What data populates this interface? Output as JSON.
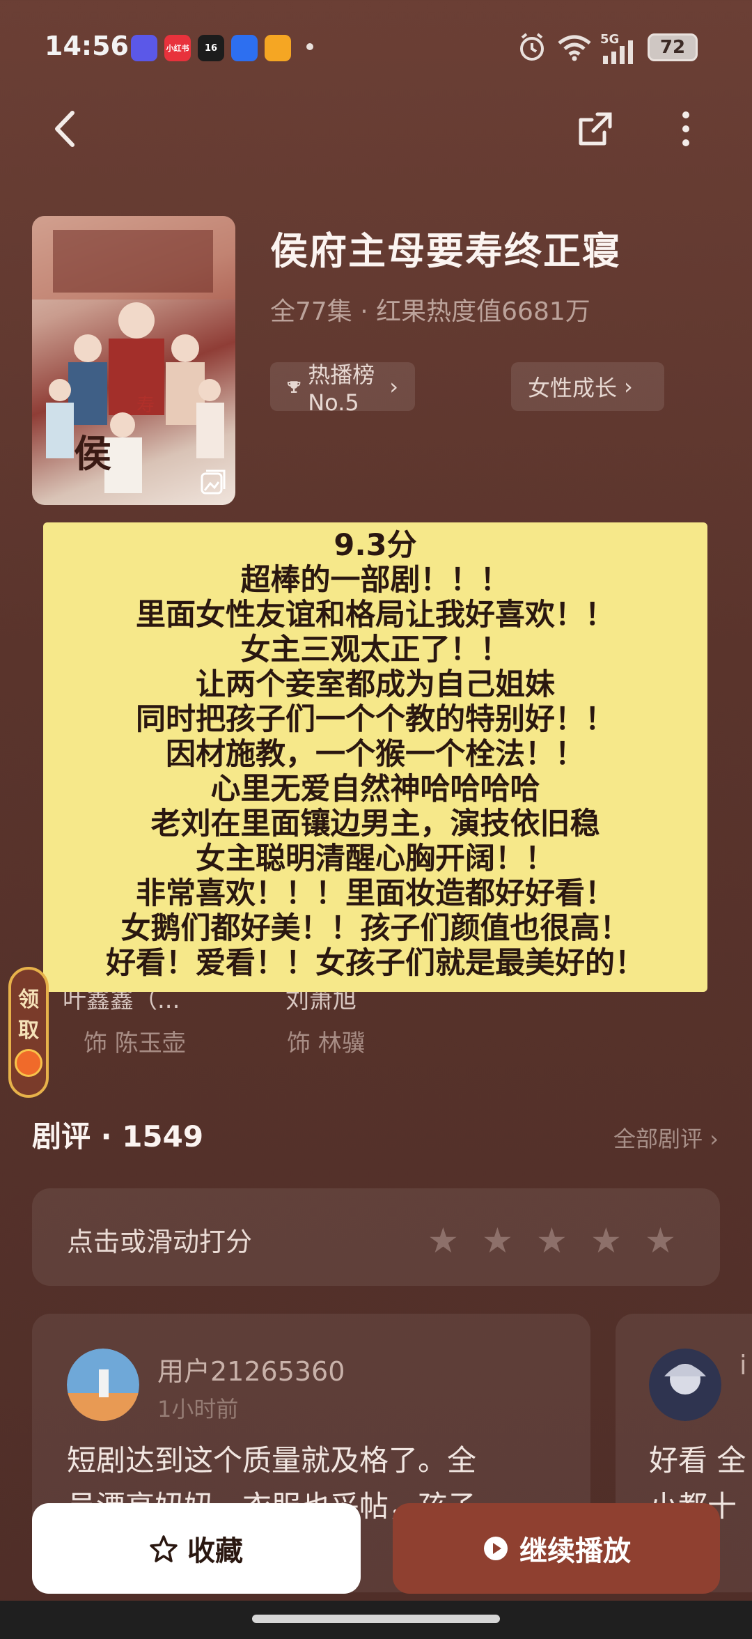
{
  "status_bar": {
    "time": "14:56",
    "apps": [
      {
        "label": "",
        "color": "#5b58e8"
      },
      {
        "label": "小红书",
        "color": "#e8323c"
      },
      {
        "label": "16",
        "color": "#1c1c1c"
      },
      {
        "label": "",
        "color": "#2d6ff0"
      },
      {
        "label": "",
        "color": "#f5a623"
      }
    ],
    "network": "5G",
    "battery": "72"
  },
  "show": {
    "title": "侯府主母要寿终正寝",
    "meta": "全77集 · 红果热度值6681万",
    "tags": [
      "热播榜 No.5",
      "女性成长"
    ]
  },
  "note_lines": [
    "9.3分",
    "超棒的一部剧！！！",
    "里面女性友谊和格局让我好喜欢！！",
    "女主三观太正了！！",
    "让两个妾室都成为自己姐妹",
    "同时把孩子们一个个教的特别好！！",
    "因材施教，一个猴一个栓法！！",
    "心里无爱自然神哈哈哈哈",
    "老刘在里面镶边男主，演技依旧稳",
    "女主聪明清醒心胸开阔！！",
    "非常喜欢！！！里面妆造都好好看！",
    "女鹅们都好美！！孩子们颜值也很高！",
    "好看！爱看！！女孩子们就是最美好的！"
  ],
  "cast": [
    {
      "name": "叶鑫鑫（...",
      "role": "饰 陈玉壶"
    },
    {
      "name": "刘萧旭",
      "role": "饰 林骥"
    }
  ],
  "ribbon": {
    "line1": "领",
    "line2": "取"
  },
  "reviews": {
    "title": "剧评 · 1549",
    "all_link": "全部剧评",
    "rate_prompt": "点击或滑动打分",
    "items": [
      {
        "user": "用户21265360",
        "time": "1小时前",
        "text_line1": "短剧达到这个质量就及格了。全",
        "text_line2": "员漂亮妞妞，衣服也妥帖，孩子"
      },
      {
        "user": "i",
        "time": "",
        "text_line1": "好看 全",
        "text_line2": "小都十"
      }
    ]
  },
  "buttons": {
    "favorite": "收藏",
    "continue": "继续播放"
  },
  "colors": {
    "background": "#5a342c",
    "note_bg": "#f6e88a",
    "play_button": "#8f4030"
  }
}
